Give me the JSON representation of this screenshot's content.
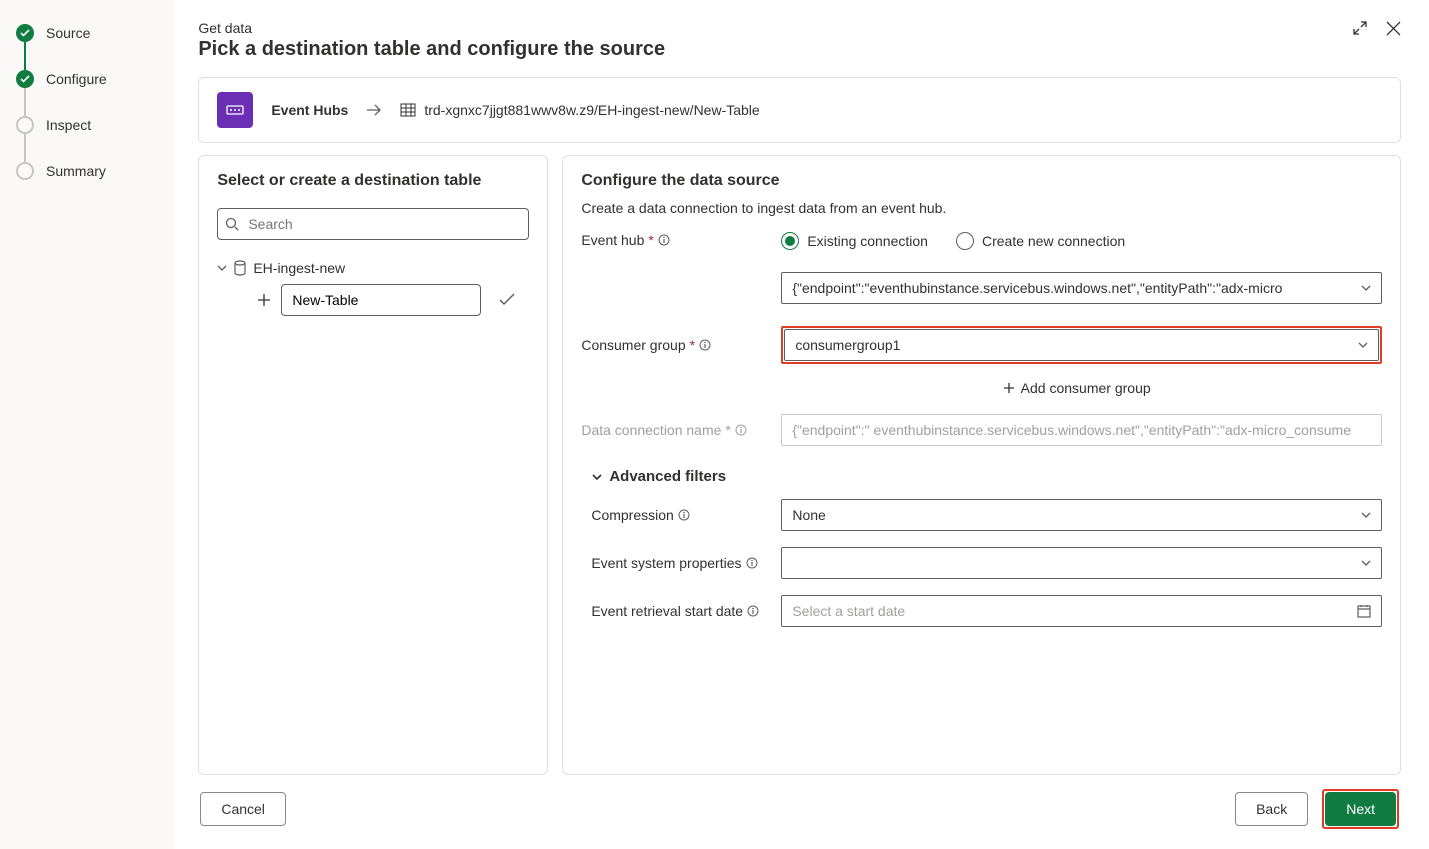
{
  "steps": [
    {
      "label": "Source",
      "state": "done"
    },
    {
      "label": "Configure",
      "state": "current"
    },
    {
      "label": "Inspect",
      "state": "pending"
    },
    {
      "label": "Summary",
      "state": "pending"
    }
  ],
  "header": {
    "subtitle": "Get data",
    "title": "Pick a destination table and configure the source"
  },
  "breadcrumb": {
    "source_label": "Event Hubs",
    "destination": "trd-xgnxc7jjgt881wwv8w.z9/EH-ingest-new/New-Table"
  },
  "left": {
    "heading": "Select or create a destination table",
    "search_placeholder": "Search",
    "db_name": "EH-ingest-new",
    "new_table_value": "New-Table"
  },
  "right": {
    "heading": "Configure the data source",
    "sub": "Create a data connection to ingest data from an event hub.",
    "labels": {
      "event_hub": "Event hub",
      "consumer_group": "Consumer group",
      "data_connection_name": "Data connection name",
      "compression": "Compression",
      "event_system_properties": "Event system properties",
      "event_retrieval_start_date": "Event retrieval start date",
      "advanced_filters": "Advanced filters"
    },
    "radio": {
      "existing": "Existing connection",
      "create_new": "Create new connection"
    },
    "event_hub_value_prefix": "{\"endpoint\":\"",
    "event_hub_value_rest": "eventhubinstance.servicebus.windows.net\",\"entityPath\":\"adx-micro",
    "consumer_group_value": "consumergroup1",
    "add_consumer_group": "Add consumer group",
    "data_conn_prefix": "{\"endpoint\":\"",
    "data_conn_rest": "eventhubinstance.servicebus.windows.net\",\"entityPath\":\"adx-micro_consume",
    "compression_value": "None",
    "event_sys_value": "",
    "start_date_placeholder": "Select a start date"
  },
  "footer": {
    "cancel": "Cancel",
    "back": "Back",
    "next": "Next"
  }
}
